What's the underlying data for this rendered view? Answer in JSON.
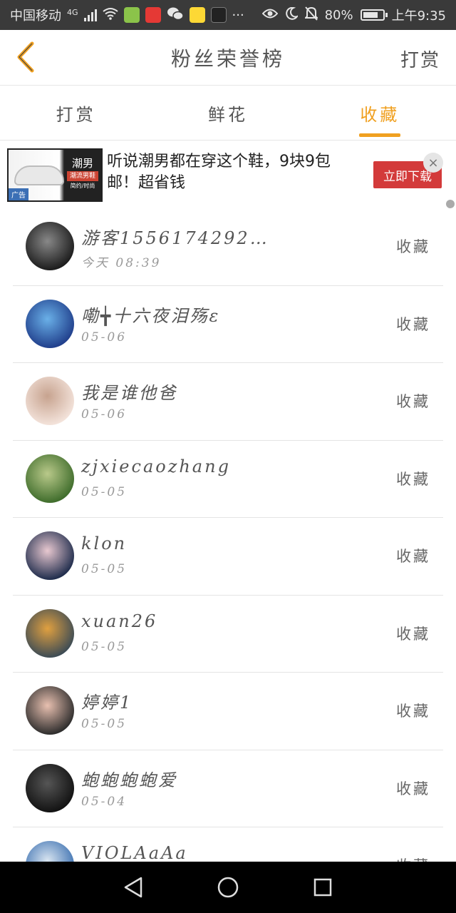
{
  "status_bar": {
    "carrier": "中国移动",
    "network": "4G",
    "battery_percent": "80%",
    "battery_level": 0.8,
    "time": "上午9:35",
    "more": "···",
    "icons": [
      "signal-icon",
      "wifi-icon",
      "app-green-icon",
      "app-red-icon",
      "wechat-icon",
      "app-yellow-icon",
      "app-dark-icon",
      "eye-icon",
      "moon-icon",
      "mute-icon",
      "battery-icon"
    ]
  },
  "header": {
    "title": "粉丝荣誉榜",
    "action": "打赏",
    "back_icon": "chevron-left-icon",
    "accent_color": "#f0a020"
  },
  "tabs": [
    {
      "label": "打赏",
      "active": false
    },
    {
      "label": "鲜花",
      "active": false
    },
    {
      "label": "收藏",
      "active": true
    }
  ],
  "ad": {
    "text": "听说潮男都在穿这个鞋，9块9包邮！超省钱",
    "button": "立即下载",
    "tag": "广告",
    "close": "×",
    "brand_line1": "潮男",
    "brand_line2": "潮流男鞋",
    "brand_line3": "简约/时尚"
  },
  "list": [
    {
      "name": "游客1556174292…",
      "date": "今天 08:39",
      "action": "收藏",
      "avatar_colors": [
        "#1a1a1a",
        "#888888"
      ]
    },
    {
      "name": "嘞╈十六夜泪殇ε",
      "date": "05-06",
      "action": "收藏",
      "avatar_colors": [
        "#1f3d8a",
        "#6ab0e8"
      ]
    },
    {
      "name": "我是谁他爸",
      "date": "05-06",
      "action": "收藏",
      "avatar_colors": [
        "#f4e4dc",
        "#c7a38f"
      ]
    },
    {
      "name": "zjxiecaozhang",
      "date": "05-05",
      "action": "收藏",
      "avatar_colors": [
        "#3d6b2a",
        "#b9c98a"
      ]
    },
    {
      "name": "klon",
      "date": "05-05",
      "action": "收藏",
      "avatar_colors": [
        "#1c2a4a",
        "#e8c8d0"
      ]
    },
    {
      "name": "xuan26",
      "date": "05-05",
      "action": "收藏",
      "avatar_colors": [
        "#3a4a55",
        "#e0a040"
      ]
    },
    {
      "name": "婷婷1",
      "date": "05-05",
      "action": "收藏",
      "avatar_colors": [
        "#2a2a2a",
        "#e8c0b0"
      ]
    },
    {
      "name": "蚫蚫蚫蚫爱",
      "date": "05-04",
      "action": "收藏",
      "avatar_colors": [
        "#111111",
        "#555555"
      ]
    },
    {
      "name": "VIOLAaAa",
      "date": "",
      "action": "收藏",
      "avatar_colors": [
        "#3a6fb0",
        "#d8e4f0"
      ]
    }
  ],
  "nav": {
    "icons": [
      "back-triangle-icon",
      "home-circle-icon",
      "recents-square-icon"
    ]
  }
}
